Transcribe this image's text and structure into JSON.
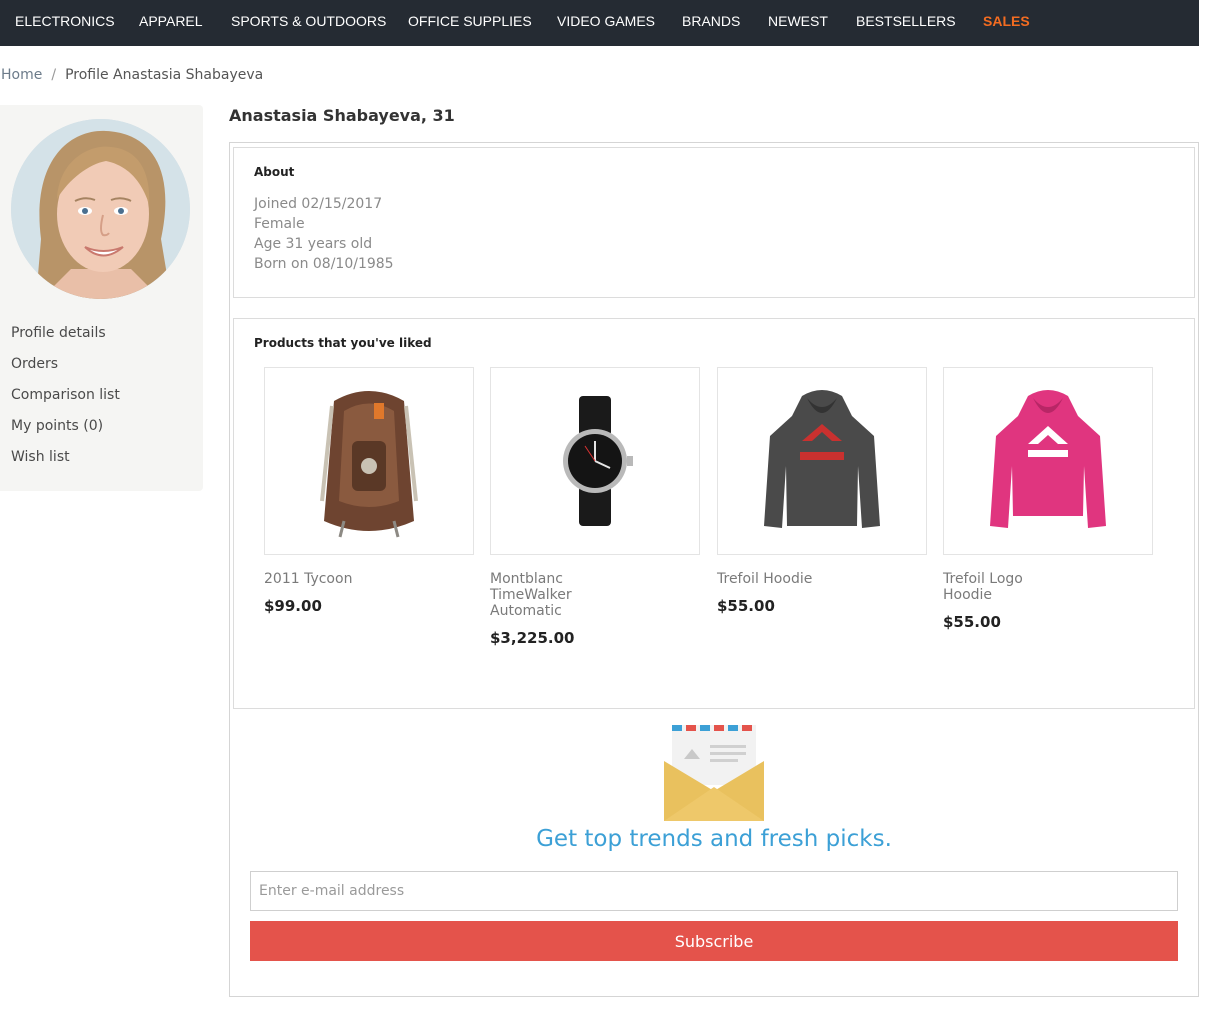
{
  "nav": {
    "items": [
      {
        "label": "ELECTRONICS"
      },
      {
        "label": "APPAREL"
      },
      {
        "label": "SPORTS & OUTDOORS"
      },
      {
        "label": "OFFICE SUPPLIES"
      },
      {
        "label": "VIDEO GAMES"
      },
      {
        "label": "BRANDS"
      },
      {
        "label": "NEWEST"
      },
      {
        "label": "BESTSELLERS"
      },
      {
        "label": "SALES"
      }
    ],
    "sales_color": "#f36c21"
  },
  "breadcrumb": {
    "home": "Home",
    "separator": "/",
    "current": "Profile Anastasia Shabayeva"
  },
  "sidebar": {
    "avatar_icon": "user-photo",
    "items": [
      {
        "label": "Profile details"
      },
      {
        "label": "Orders"
      },
      {
        "label": "Comparison list"
      },
      {
        "label": "My points (0)"
      },
      {
        "label": "Wish list"
      }
    ]
  },
  "profile": {
    "title": "Anastasia Shabayeva, 31"
  },
  "about": {
    "heading": "About",
    "lines": [
      "Joined 02/15/2017",
      "Female",
      "Age 31 years old",
      "Born on 08/10/1985"
    ]
  },
  "liked": {
    "heading": "Products that you've liked",
    "products": [
      {
        "name": "2011 Tycoon",
        "price": "$99.00",
        "image_icon": "backpack-image"
      },
      {
        "name": "Montblanc TimeWalker Automatic",
        "price": "$3,225.00",
        "image_icon": "watch-image"
      },
      {
        "name": "Trefoil Hoodie",
        "price": "$55.00",
        "image_icon": "grey-hoodie-image"
      },
      {
        "name": "Trefoil Logo Hoodie",
        "price": "$55.00",
        "image_icon": "pink-hoodie-image"
      }
    ]
  },
  "newsletter": {
    "icon": "envelope-icon",
    "title": "Get top trends and fresh picks.",
    "placeholder": "Enter e-mail address",
    "button_label": "Subscribe",
    "title_color": "#3ca0d6",
    "button_color": "#e4534b"
  }
}
